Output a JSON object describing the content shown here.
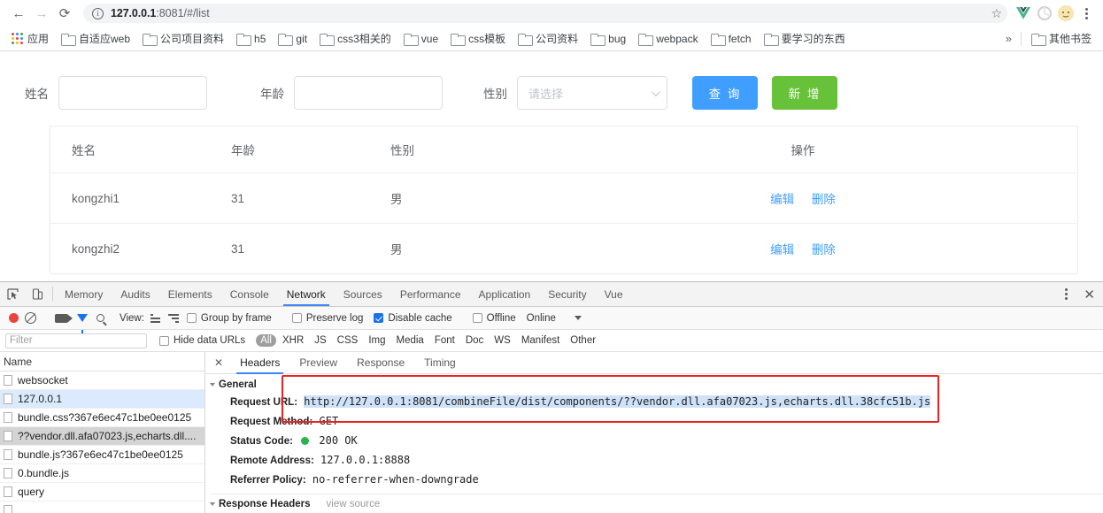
{
  "browser": {
    "nav": {
      "back_icon": "arrow-left-icon",
      "forward_icon": "arrow-right-icon",
      "reload_icon": "reload-icon"
    },
    "omnibox": {
      "info_glyph": "i",
      "url_host": "127.0.0.1",
      "url_rest": ":8081/#/list",
      "star_glyph": "☆"
    },
    "toolbar_icons": [
      "vue-devtools-icon",
      "extension-icon",
      "profile-avatar-icon",
      "chrome-menu-icon"
    ],
    "bookmarks": {
      "apps_label": "应用",
      "items": [
        "自适应web",
        "公司项目资料",
        "h5",
        "git",
        "css3相关的",
        "vue",
        "css模板",
        "公司资料",
        "bug",
        "webpack",
        "fetch",
        "要学习的东西"
      ],
      "overflow_glyph": "»",
      "other_bookmarks": "其他书签"
    }
  },
  "page": {
    "form": {
      "name_label": "姓名",
      "name_value": "",
      "name_placeholder": "",
      "age_label": "年龄",
      "age_value": "",
      "age_placeholder": "",
      "gender_label": "性别",
      "gender_placeholder": "请选择",
      "query_button": "查 询",
      "add_button": "新 增"
    },
    "table": {
      "columns": [
        "姓名",
        "年龄",
        "性别",
        "操作"
      ],
      "rows": [
        {
          "name": "kongzhi1",
          "age": "31",
          "gender": "男",
          "edit": "编辑",
          "delete": "删除"
        },
        {
          "name": "kongzhi2",
          "age": "31",
          "gender": "男",
          "edit": "编辑",
          "delete": "删除"
        }
      ]
    },
    "accent_primary": "#409eff",
    "accent_success": "#67c23a"
  },
  "devtools": {
    "tabs": [
      "Memory",
      "Audits",
      "Elements",
      "Console",
      "Network",
      "Sources",
      "Performance",
      "Application",
      "Security",
      "Vue"
    ],
    "active_tab": "Network",
    "close_glyph": "✕",
    "network_toolbar": {
      "view_label": "View:",
      "group_by_frame": "Group by frame",
      "group_by_frame_checked": false,
      "preserve_log": "Preserve log",
      "preserve_log_checked": false,
      "disable_cache": "Disable cache",
      "disable_cache_checked": true,
      "offline": "Offline",
      "offline_checked": false,
      "throttling": "Online"
    },
    "filter_bar": {
      "filter_placeholder": "Filter",
      "hide_data_urls": "Hide data URLs",
      "hide_data_urls_checked": false,
      "types": [
        "All",
        "XHR",
        "JS",
        "CSS",
        "Img",
        "Media",
        "Font",
        "Doc",
        "WS",
        "Manifest",
        "Other"
      ],
      "active_type": "All"
    },
    "request_list": {
      "header": "Name",
      "rows": [
        {
          "name": "websocket",
          "state": "none"
        },
        {
          "name": "127.0.0.1",
          "state": "blue"
        },
        {
          "name": "bundle.css?367e6ec47c1be0ee0125",
          "state": "none"
        },
        {
          "name": "??vendor.dll.afa07023.js,echarts.dll....",
          "state": "gray"
        },
        {
          "name": "bundle.js?367e6ec47c1be0ee0125",
          "state": "none"
        },
        {
          "name": "0.bundle.js",
          "state": "none"
        },
        {
          "name": "query",
          "state": "none"
        },
        {
          "name": "",
          "state": "none"
        }
      ]
    },
    "detail": {
      "tabs": [
        "Headers",
        "Preview",
        "Response",
        "Timing"
      ],
      "active_tab": "Headers",
      "general_section": "General",
      "request_url_key": "Request URL:",
      "request_url_value": "http://127.0.0.1:8081/combineFile/dist/components/??vendor.dll.afa07023.js,echarts.dll.38cfc51b.js",
      "request_method_key": "Request Method:",
      "request_method_value": "GET",
      "status_code_key": "Status Code:",
      "status_code_value": "200 OK",
      "remote_address_key": "Remote Address:",
      "remote_address_value": "127.0.0.1:8888",
      "referrer_policy_key": "Referrer Policy:",
      "referrer_policy_value": "no-referrer-when-downgrade",
      "response_headers_section": "Response Headers",
      "view_source": "view source",
      "annotation_color": "#ee2222"
    }
  }
}
